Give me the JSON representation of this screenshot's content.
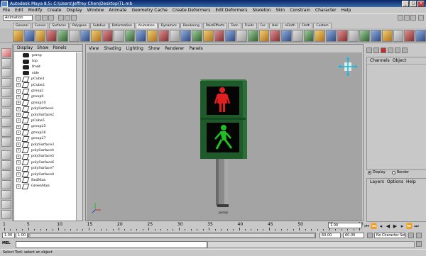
{
  "window": {
    "title": "Autodesk Maya 8.5: C:\\Users\\Jeffrey Chen\\Desktop\\TL.mb"
  },
  "menubar": [
    "File",
    "Edit",
    "Modify",
    "Create",
    "Display",
    "Window",
    "Animate",
    "Geometry Cache",
    "Create Deformers",
    "Edit Deformers",
    "Skeleton",
    "Skin",
    "Constrain",
    "Character",
    "Help"
  ],
  "statusline": {
    "mode": "Animation"
  },
  "shelf_tabs": [
    "General",
    "Curves",
    "Surfaces",
    "Polygons",
    "Subdivs",
    "Deformation",
    "Animation",
    "Dynamics",
    "Rendering",
    "PaintEffects",
    "Toon",
    "Fluids",
    "Fur",
    "Hair",
    "nCloth",
    "Cloth",
    "Custom"
  ],
  "outliner": {
    "menu": [
      "Display",
      "Show",
      "Panels"
    ],
    "items": [
      {
        "label": "persp",
        "icon": "camera-icon",
        "exp": false
      },
      {
        "label": "top",
        "icon": "camera-icon",
        "exp": false
      },
      {
        "label": "front",
        "icon": "camera-icon",
        "exp": false
      },
      {
        "label": "side",
        "icon": "camera-icon",
        "exp": false
      },
      {
        "label": "pCube1",
        "icon": "mesh-icon",
        "exp": true
      },
      {
        "label": "pCube2",
        "icon": "mesh-icon",
        "exp": true
      },
      {
        "label": "group2",
        "icon": "group-icon",
        "exp": true
      },
      {
        "label": "group9",
        "icon": "group-icon",
        "exp": true
      },
      {
        "label": "group10",
        "icon": "group-icon",
        "exp": true
      },
      {
        "label": "polySurface1",
        "icon": "mesh-icon",
        "exp": true
      },
      {
        "label": "polySurface2",
        "icon": "mesh-icon",
        "exp": true
      },
      {
        "label": "pCube5",
        "icon": "mesh-icon",
        "exp": true
      },
      {
        "label": "group25",
        "icon": "group-icon",
        "exp": true
      },
      {
        "label": "group26",
        "icon": "group-icon",
        "exp": true
      },
      {
        "label": "group27",
        "icon": "group-icon",
        "exp": true
      },
      {
        "label": "polySurface3",
        "icon": "mesh-icon",
        "exp": true
      },
      {
        "label": "polySurface4",
        "icon": "mesh-icon",
        "exp": true
      },
      {
        "label": "polySurface5",
        "icon": "mesh-icon",
        "exp": true
      },
      {
        "label": "polySurface6",
        "icon": "mesh-icon",
        "exp": true
      },
      {
        "label": "polySurface7",
        "icon": "mesh-icon",
        "exp": true
      },
      {
        "label": "polySurface8",
        "icon": "mesh-icon",
        "exp": true
      },
      {
        "label": "RedMan",
        "icon": "mesh-icon",
        "exp": true
      },
      {
        "label": "GreenMan",
        "icon": "mesh-icon",
        "exp": true
      }
    ]
  },
  "viewport": {
    "menu": [
      "View",
      "Shading",
      "Lighting",
      "Show",
      "Renderer",
      "Panels"
    ],
    "camera_label": "persp"
  },
  "channelbox": {
    "menu": [
      "Channels",
      "Object"
    ],
    "display_label": "Display",
    "render_label": "Render"
  },
  "layers": {
    "menu": [
      "Layers",
      "Options",
      "Help"
    ]
  },
  "timeslider": {
    "ticks": [
      "1",
      "5",
      "10",
      "15",
      "20",
      "25",
      "30",
      "35",
      "40",
      "45",
      "50",
      "55",
      "60"
    ],
    "current": "1.00"
  },
  "rangeslider": {
    "start": "1.00",
    "inner_start": "1.00",
    "inner_end": "60.00",
    "end": "60.00",
    "charset": "No Character Set"
  },
  "cmdline": {
    "label": "MEL"
  },
  "helpline": {
    "text": "Select Tool: select an object"
  },
  "colors": {
    "red_light": "#e02020",
    "green_light": "#20c020",
    "viewport_bg": "#a4a4a4",
    "housing": "#1f5a2a"
  }
}
